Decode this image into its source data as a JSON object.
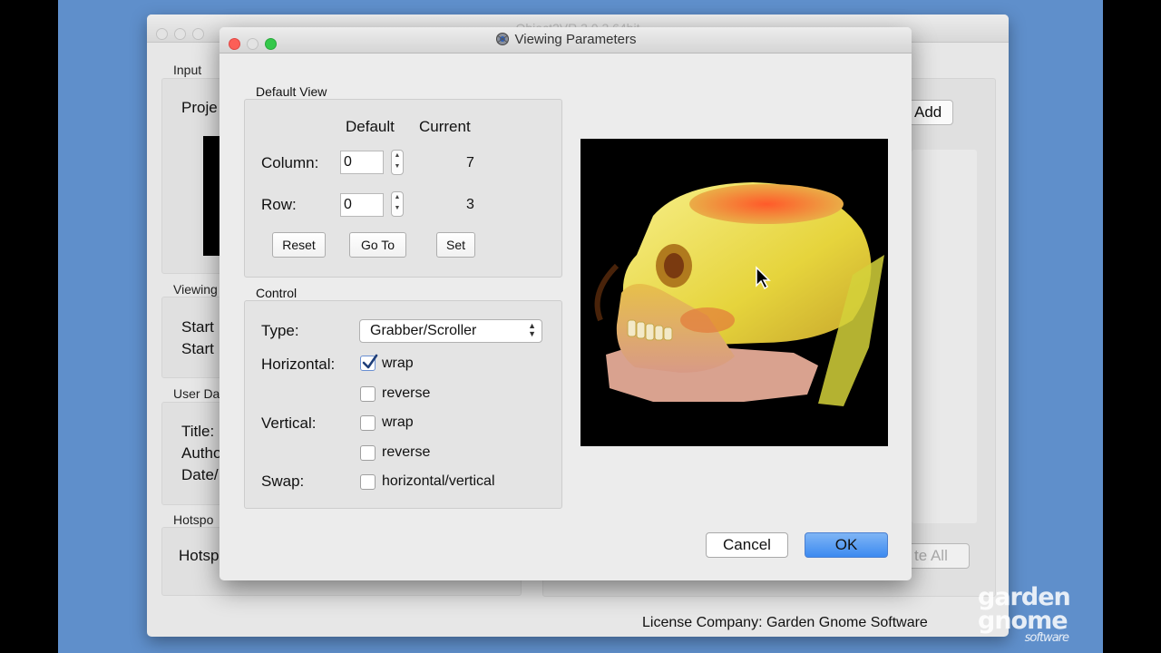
{
  "background_window": {
    "title": "Object2VR 3.0.3 64bit",
    "input_label": "Input",
    "project_text": "Proje",
    "add_button": "Add",
    "viewing_label": "Viewing",
    "start_1": "Start",
    "start_2": "Start",
    "user_data_label": "User Da",
    "title_field": "Title:",
    "author_field": "Autho",
    "date_field": "Date/",
    "hotspots_label": "Hotspo",
    "hotspots_text": "Hotsp",
    "delete_all_button": "te All",
    "license": "License Company: Garden Gnome Software"
  },
  "logo": {
    "line1": "garden",
    "line2": "gnome",
    "line3": "software"
  },
  "dialog": {
    "title": "Viewing Parameters",
    "default_view": {
      "section_label": "Default View",
      "header_default": "Default",
      "header_current": "Current",
      "column_label": "Column:",
      "column_default": "0",
      "column_current": "7",
      "row_label": "Row:",
      "row_default": "0",
      "row_current": "3",
      "reset_button": "Reset",
      "goto_button": "Go To",
      "set_button": "Set"
    },
    "control": {
      "section_label": "Control",
      "type_label": "Type:",
      "type_value": "Grabber/Scroller",
      "horizontal_label": "Horizontal:",
      "h_wrap": "wrap",
      "h_wrap_checked": true,
      "h_reverse": "reverse",
      "h_reverse_checked": false,
      "vertical_label": "Vertical:",
      "v_wrap": "wrap",
      "v_wrap_checked": false,
      "v_reverse": "reverse",
      "v_reverse_checked": false,
      "swap_label": "Swap:",
      "swap_option": "horizontal/vertical",
      "swap_checked": false
    },
    "cancel_button": "Cancel",
    "ok_button": "OK"
  }
}
